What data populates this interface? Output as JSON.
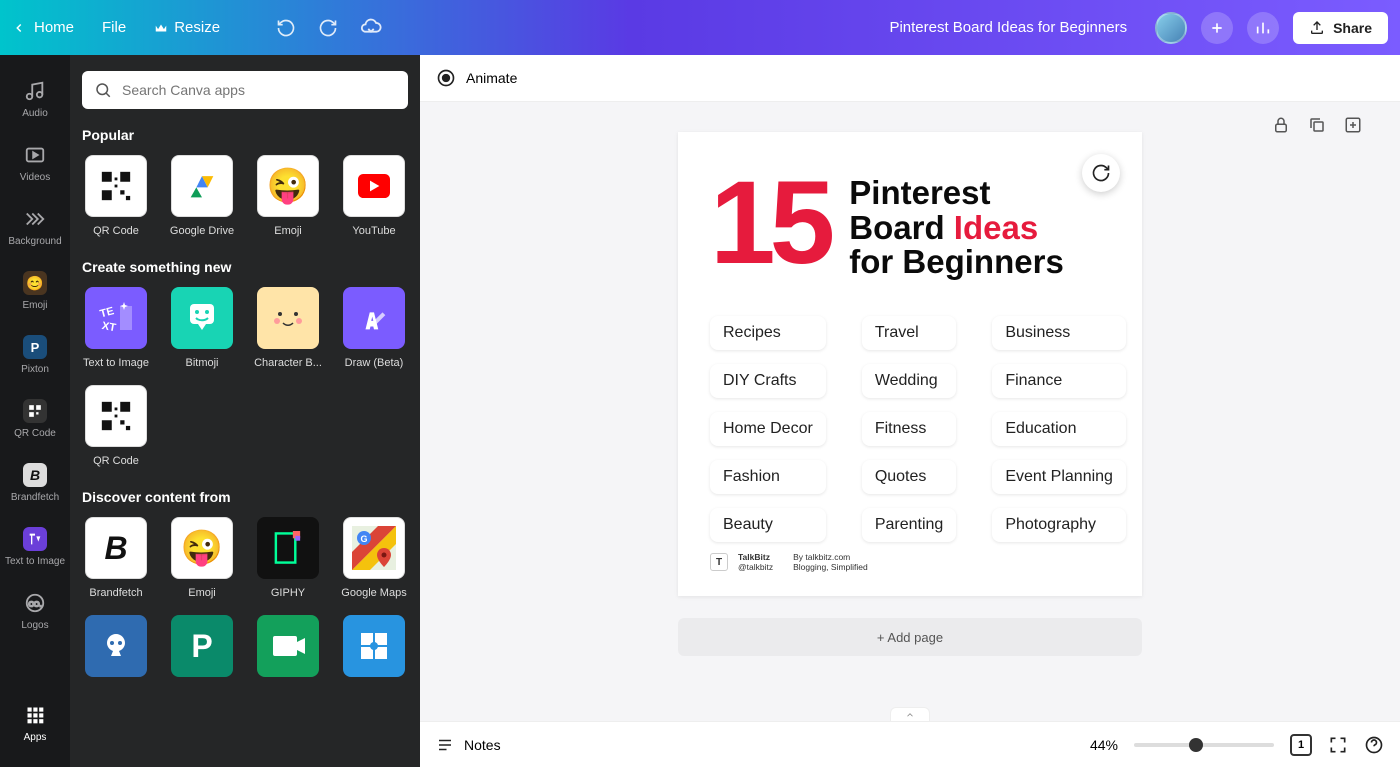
{
  "topbar": {
    "home": "Home",
    "file": "File",
    "resize": "Resize",
    "doc_title": "Pinterest Board Ideas for Beginners",
    "share": "Share"
  },
  "rail": [
    {
      "icon": "audio",
      "label": "Audio"
    },
    {
      "icon": "videos",
      "label": "Videos"
    },
    {
      "icon": "background",
      "label": "Background"
    },
    {
      "icon": "emoji",
      "label": "Emoji"
    },
    {
      "icon": "pixton",
      "label": "Pixton"
    },
    {
      "icon": "qrcode",
      "label": "QR Code"
    },
    {
      "icon": "brandfetch",
      "label": "Brandfetch"
    },
    {
      "icon": "t2i",
      "label": "Text to Image"
    },
    {
      "icon": "logos",
      "label": "Logos"
    },
    {
      "icon": "apps",
      "label": "Apps",
      "active": true
    }
  ],
  "search": {
    "placeholder": "Search Canva apps"
  },
  "sections": {
    "popular": {
      "title": "Popular",
      "items": [
        {
          "label": "QR Code",
          "bg": "#fff",
          "kind": "qr"
        },
        {
          "label": "Google Drive",
          "bg": "#fff",
          "kind": "gdrive"
        },
        {
          "label": "Emoji",
          "bg": "#fff",
          "kind": "emoji"
        },
        {
          "label": "YouTube",
          "bg": "#fff",
          "kind": "youtube"
        }
      ]
    },
    "create": {
      "title": "Create something new",
      "items": [
        {
          "label": "Text to Image",
          "bg": "#7b5cff",
          "kind": "t2i"
        },
        {
          "label": "Bitmoji",
          "bg": "#18d4b4",
          "kind": "bitmoji"
        },
        {
          "label": "Character B...",
          "bg": "#ffe4a8",
          "kind": "char"
        },
        {
          "label": "Draw (Beta)",
          "bg": "#7b5cff",
          "kind": "draw"
        },
        {
          "label": "QR Code",
          "bg": "#fff",
          "kind": "qr"
        }
      ]
    },
    "discover": {
      "title": "Discover content from",
      "items": [
        {
          "label": "Brandfetch",
          "bg": "#fff",
          "kind": "brandfetch"
        },
        {
          "label": "Emoji",
          "bg": "#fff",
          "kind": "emoji"
        },
        {
          "label": "GIPHY",
          "bg": "#111",
          "kind": "giphy"
        },
        {
          "label": "Google Maps",
          "bg": "#fff",
          "kind": "gmaps"
        },
        {
          "label": "",
          "bg": "#2f6bb0",
          "kind": "mojo"
        },
        {
          "label": "",
          "bg": "#0a8a6a",
          "kind": "pexels"
        },
        {
          "label": "",
          "bg": "#13a05b",
          "kind": "pexelsv"
        },
        {
          "label": "",
          "bg": "#2894e0",
          "kind": "pixabay"
        }
      ]
    }
  },
  "canvas": {
    "animate": "Animate",
    "add_page": "+ Add page",
    "page": {
      "big_number": "15",
      "title_line1": "Pinterest",
      "title_line2a": "Board ",
      "title_line2b": "Ideas",
      "title_line3": "for Beginners",
      "pills": [
        "Recipes",
        "Travel",
        "Business",
        "DIY Crafts",
        "Wedding",
        "Finance",
        "Home Decor",
        "Fitness",
        "Education",
        "Fashion",
        "Quotes",
        "Event Planning",
        "Beauty",
        "Parenting",
        "Photography"
      ],
      "footer": {
        "brand": "TalkBitz",
        "handle": "@talkbitz",
        "by": "By talkbitz.com",
        "tagline": "Blogging, Simplified"
      }
    }
  },
  "bottombar": {
    "notes": "Notes",
    "zoom": "44%",
    "page_indicator": "1"
  }
}
